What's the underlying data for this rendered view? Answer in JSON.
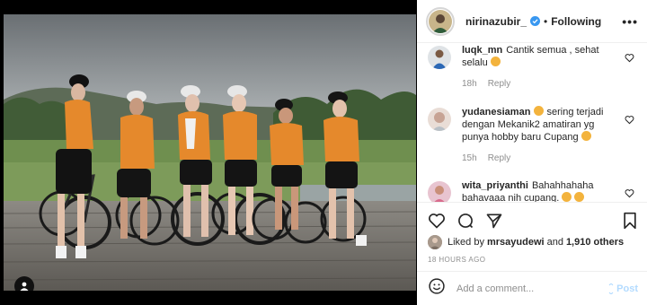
{
  "post": {
    "username": "nirinazubir_",
    "verified": true,
    "following_label": "Following",
    "dot": "•",
    "more_label": "•••"
  },
  "comments": [
    {
      "user": "luqk_mn",
      "text": "Cantik semua , sehat selalu",
      "age": "18h",
      "reply_label": "Reply",
      "avatar_icon": "blue-shirt-avatar"
    },
    {
      "user": "yudanesiaman",
      "text": "sering terjadi dengan Mekanik2 amatiran yg punya hobby baru Cupang",
      "age": "15h",
      "reply_label": "Reply",
      "avatar_icon": "portrait-avatar"
    },
    {
      "user": "wita_priyanthi",
      "text": "Bahahhahaha bahavaaa nih cupang.",
      "age": "",
      "reply_label": "",
      "avatar_icon": "pink-avatar"
    }
  ],
  "likes": {
    "prefix": "Liked by",
    "user": "mrsayudewi",
    "and": "and",
    "count": "1,910 others"
  },
  "time_ago": "18 HOURS AGO",
  "add_comment": {
    "placeholder": "Add a comment...",
    "post_label": "Post"
  },
  "icons": [
    "heart-icon",
    "comment-icon",
    "share-icon",
    "bookmark-icon",
    "emoji-icon",
    "user-tag-icon",
    "verified-icon"
  ],
  "colors": {
    "jersey": "#e5892c",
    "verified_blue": "#3897f0",
    "post_disabled": "#b3dbff",
    "muted_text": "#8e8e8e"
  }
}
